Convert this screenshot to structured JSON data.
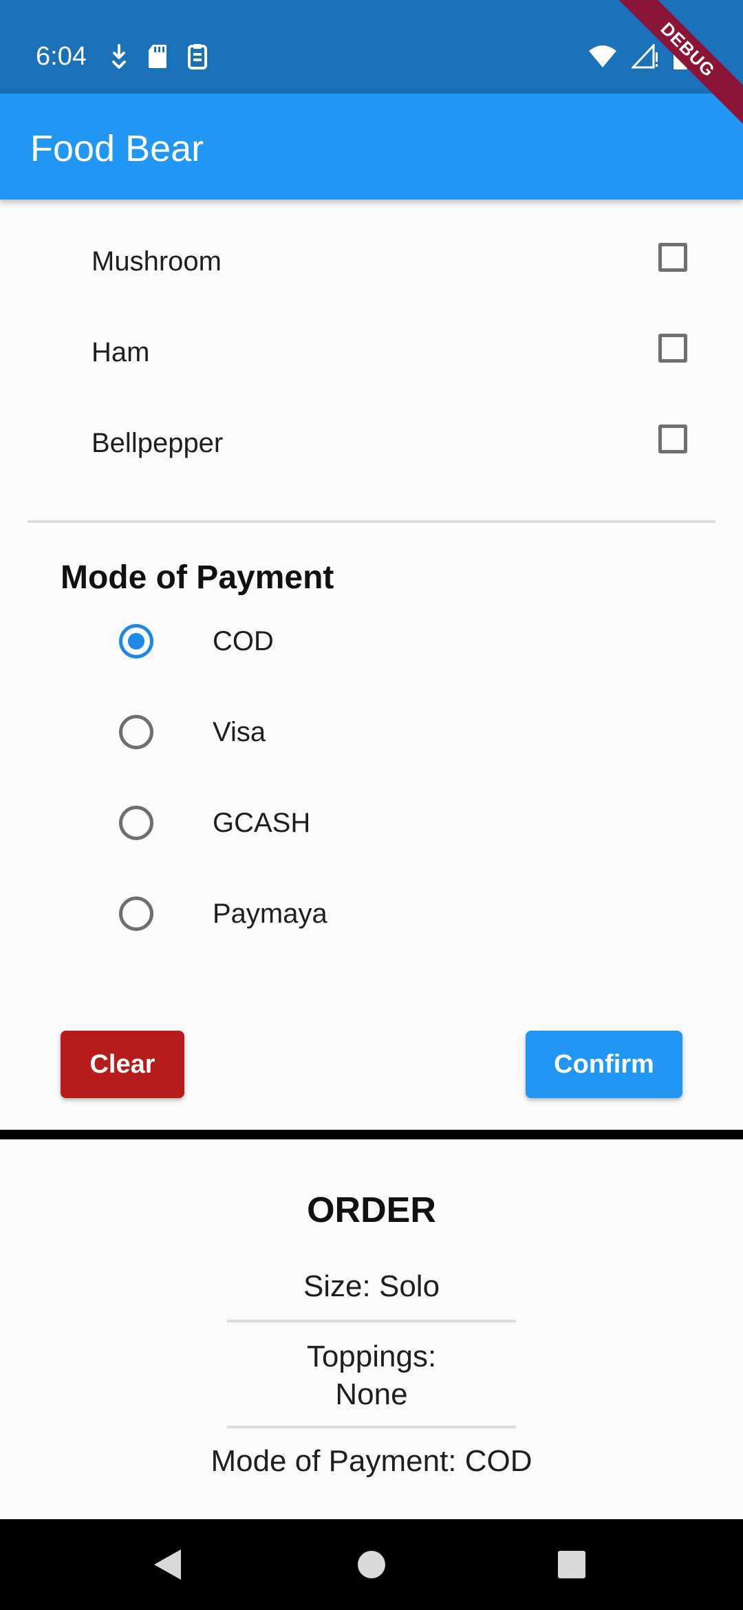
{
  "status_bar": {
    "time": "6:04",
    "left_icons": [
      "download-icon",
      "sd-card-icon",
      "clipboard-icon"
    ],
    "right_icons": [
      "wifi-icon",
      "signal-icon",
      "battery-icon"
    ]
  },
  "debug_banner": "DEBUG",
  "app_bar": {
    "title": "Food Bear"
  },
  "toppings": {
    "items": [
      {
        "label": "Mushroom",
        "checked": false
      },
      {
        "label": "Ham",
        "checked": false
      },
      {
        "label": "Bellpepper",
        "checked": false
      }
    ]
  },
  "payment": {
    "title": "Mode of Payment",
    "options": [
      {
        "label": "COD",
        "selected": true
      },
      {
        "label": "Visa",
        "selected": false
      },
      {
        "label": "GCASH",
        "selected": false
      },
      {
        "label": "Paymaya",
        "selected": false
      }
    ]
  },
  "actions": {
    "clear_label": "Clear",
    "confirm_label": "Confirm"
  },
  "order": {
    "title": "ORDER",
    "size": "Size: Solo",
    "toppings_label": "Toppings:",
    "toppings_value": "None",
    "payment": "Mode of Payment: COD"
  },
  "colors": {
    "status_bar": "#1a71b8",
    "app_bar": "#2196f3",
    "accent": "#1e88e5",
    "clear_button": "#b71c1c",
    "confirm_button": "#2196f3",
    "debug_ribbon": "#8a1538"
  }
}
